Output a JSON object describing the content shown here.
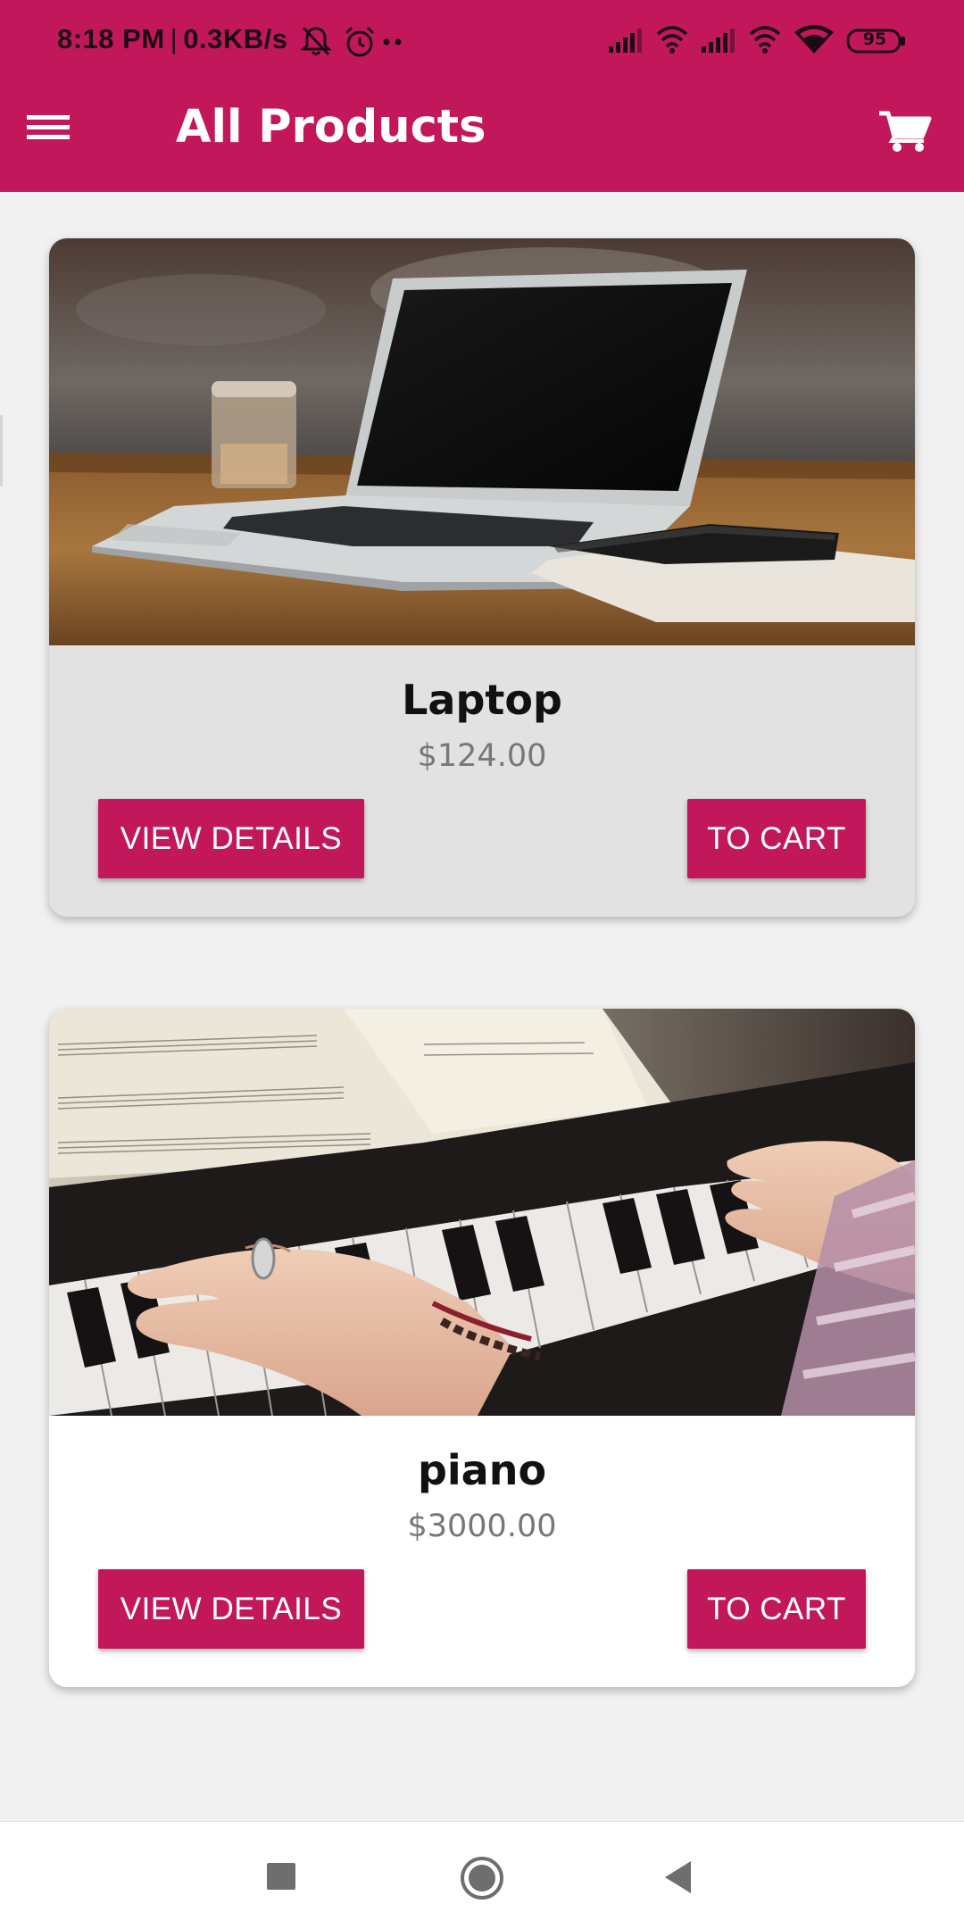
{
  "status_bar": {
    "time": "8:18 PM",
    "separator": "|",
    "net_speed": "0.3KB/s",
    "battery": "95",
    "icons": [
      "bell-off-icon",
      "alarm-icon",
      "more-dots-icon",
      "signal-icon",
      "wifi-calling-icon",
      "signal-icon",
      "wifi-calling-icon",
      "wifi-icon",
      "battery-icon"
    ]
  },
  "toolbar": {
    "title": "All Products",
    "menu_icon": "menu-icon",
    "cart_icon": "cart-icon"
  },
  "products": [
    {
      "name": "Laptop",
      "price": "$124.00",
      "image_icon": "laptop-photo",
      "details_label": "VIEW DETAILS",
      "cart_label": "TO CART"
    },
    {
      "name": "piano",
      "price": "$3000.00",
      "image_icon": "piano-photo",
      "details_label": "VIEW DETAILS",
      "cart_label": "TO CART"
    }
  ],
  "nav_bar": {
    "icons": [
      "recents-square-icon",
      "home-circle-icon",
      "back-triangle-icon"
    ]
  },
  "colors": {
    "primary": "#c2185b",
    "background": "#f1f1f1",
    "card_pressed": "#e2e2e2",
    "card": "#ffffff"
  }
}
